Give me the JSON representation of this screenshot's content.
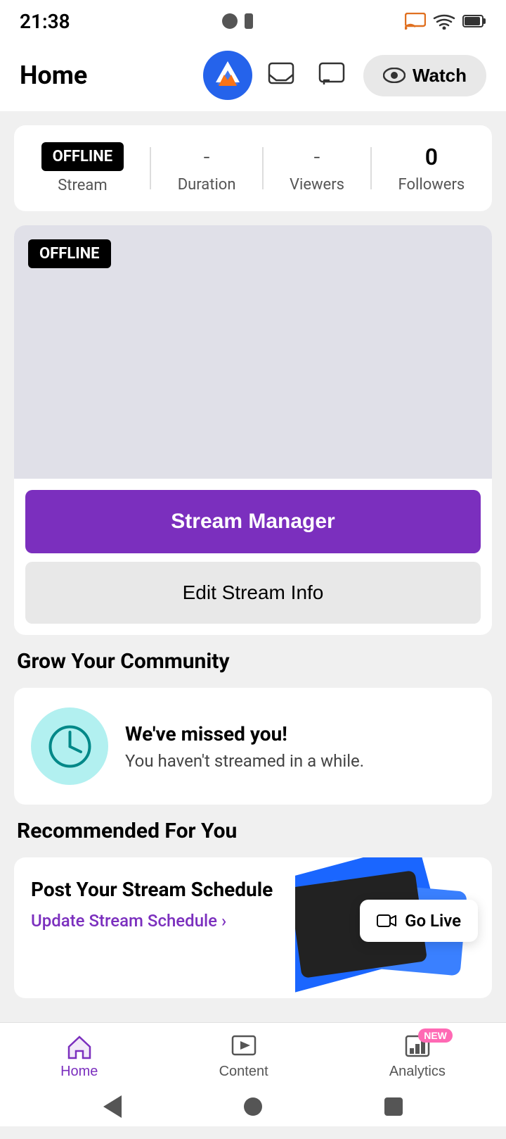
{
  "statusBar": {
    "time": "21:38"
  },
  "header": {
    "title": "Home",
    "watchLabel": "Watch"
  },
  "stats": {
    "offlineLabel": "OFFLINE",
    "streamLabel": "Stream",
    "durationLabel": "Duration",
    "durationValue": "-",
    "viewersLabel": "Viewers",
    "viewersValue": "-",
    "followersLabel": "Followers",
    "followersValue": "0"
  },
  "streamPreview": {
    "offlineBadge": "OFFLINE",
    "streamManagerLabel": "Stream Manager",
    "editStreamLabel": "Edit Stream Info"
  },
  "growCommunity": {
    "sectionTitle": "Grow Your Community",
    "cardTitle": "We've missed you!",
    "cardSubtitle": "You haven't streamed in a while."
  },
  "recommended": {
    "sectionTitle": "Recommended For You",
    "cardTitle": "Post Your Stream Schedule",
    "updateLinkLabel": "Update Stream Schedule",
    "goLiveLabel": "Go Live"
  },
  "bottomNav": {
    "homeLabel": "Home",
    "contentLabel": "Content",
    "analyticsLabel": "Analytics",
    "newBadge": "NEW"
  }
}
